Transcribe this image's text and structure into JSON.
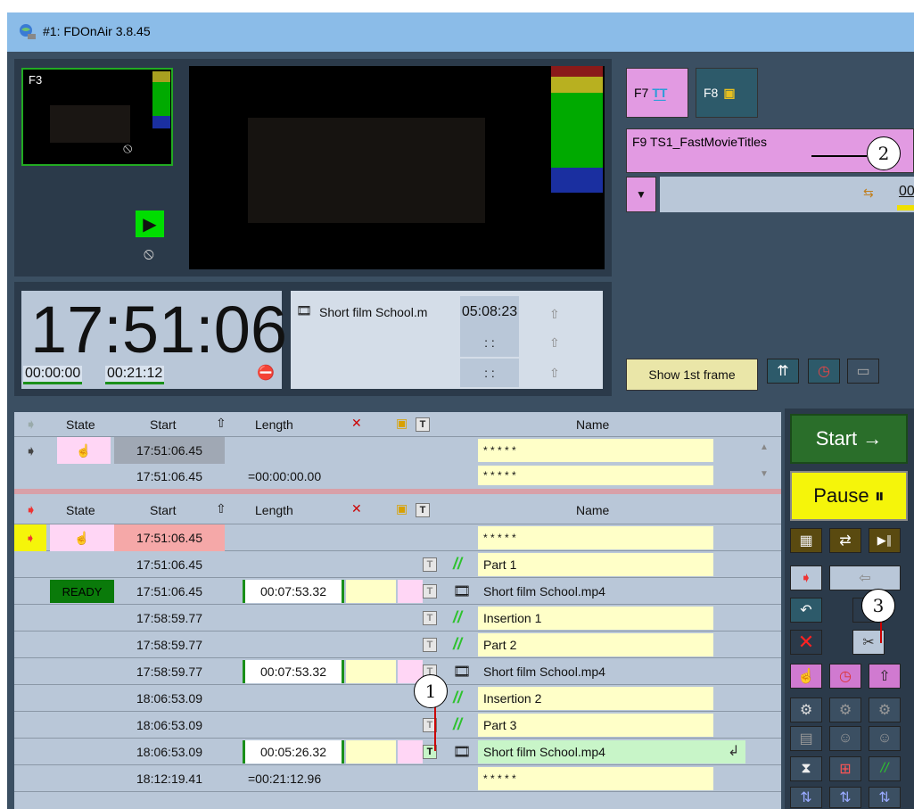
{
  "window": {
    "title": "#1: FDOnAir 3.8.45"
  },
  "preview": {
    "label": "F3"
  },
  "clock": {
    "time": "17:51:06",
    "elapsed": "00:00:00",
    "remaining": "00:21:12"
  },
  "now_item": {
    "name": "Short film School.m",
    "duration": "05:08:23",
    "blank1": ": :",
    "blank2": ": :"
  },
  "templates": {
    "f7": "F7",
    "f8": "F8",
    "f9": "F9 TS1_FastMovieTitles",
    "counter": "00"
  },
  "toolbar": {
    "show_first_frame": "Show 1st frame"
  },
  "columns": {
    "state": "State",
    "start": "Start",
    "length": "Length",
    "name": "Name"
  },
  "top_rows": [
    {
      "start": "17:51:06.45",
      "length": "",
      "name": "* * * * *"
    },
    {
      "start": "17:51:06.45",
      "length": "=00:00:00.00",
      "name": "* * * * *"
    }
  ],
  "rows": [
    {
      "state": "",
      "start": "17:51:06.45",
      "length": "",
      "name": "* * * * *"
    },
    {
      "state": "",
      "start": "17:51:06.45",
      "length": "",
      "name": "Part 1"
    },
    {
      "state": "READY",
      "start": "17:51:06.45",
      "length": "00:07:53.32",
      "name": "Short film School.mp4"
    },
    {
      "state": "",
      "start": "17:58:59.77",
      "length": "",
      "name": "Insertion 1"
    },
    {
      "state": "",
      "start": "17:58:59.77",
      "length": "",
      "name": "Part 2"
    },
    {
      "state": "",
      "start": "17:58:59.77",
      "length": "00:07:53.32",
      "name": "Short film School.mp4"
    },
    {
      "state": "",
      "start": "18:06:53.09",
      "length": "",
      "name": "Insertion 2"
    },
    {
      "state": "",
      "start": "18:06:53.09",
      "length": "",
      "name": "Part 3"
    },
    {
      "state": "",
      "start": "18:06:53.09",
      "length": "00:05:26.32",
      "name": "Short film School.mp4"
    },
    {
      "state": "",
      "start": "18:12:19.41",
      "length": "=00:21:12.96",
      "name": "* * * * *"
    }
  ],
  "controls": {
    "start": "Start →",
    "pause": "Pause ⏸"
  },
  "callouts": {
    "c1": "1",
    "c2": "2",
    "c3": "3"
  },
  "colors": {
    "title_bar": "#8bbce8",
    "start_btn": "#2a6e2a",
    "pause_btn": "#f5f50a",
    "ready": "#0a7a0a"
  }
}
